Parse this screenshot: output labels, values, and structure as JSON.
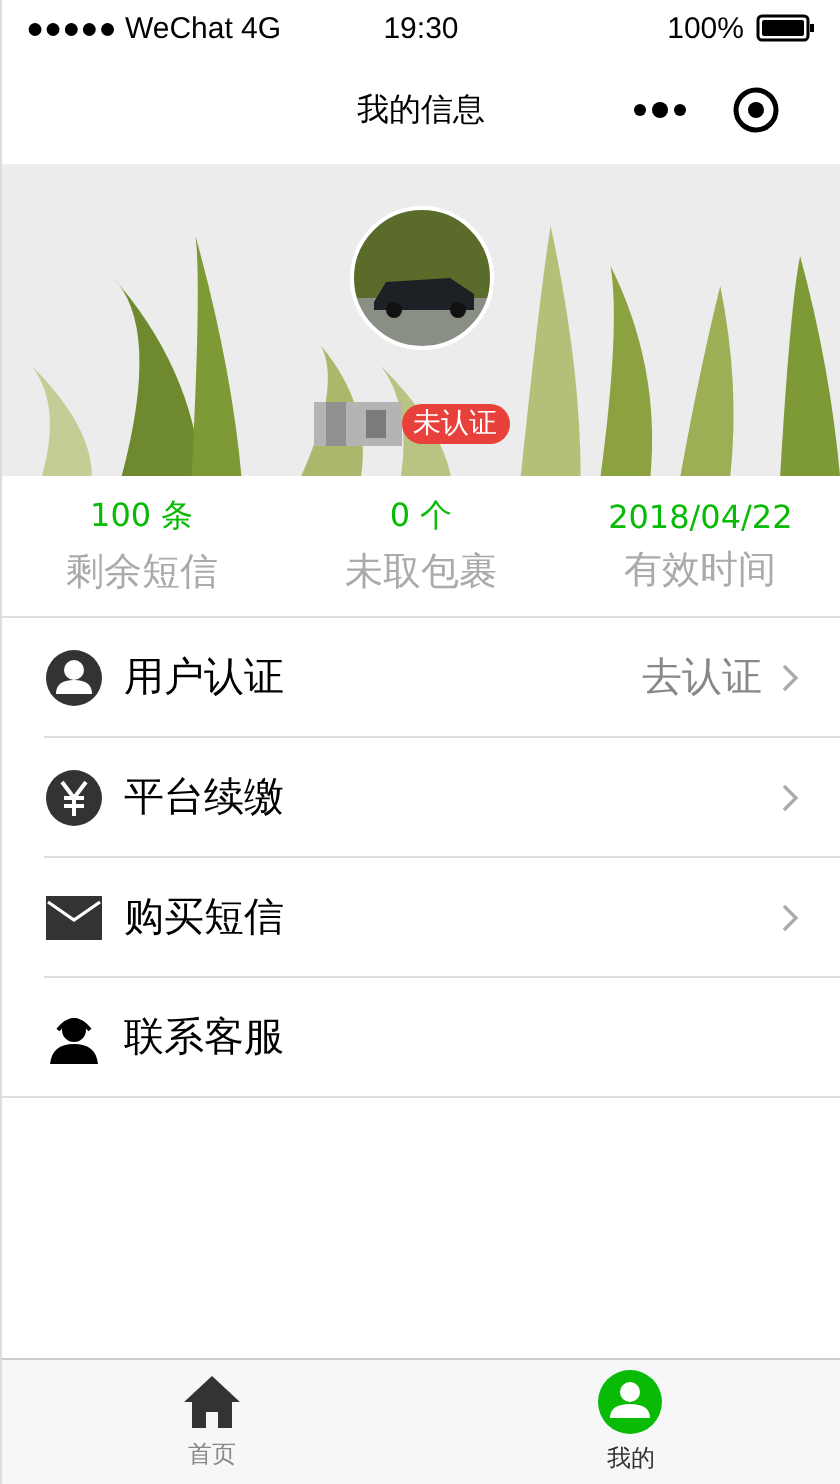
{
  "status_bar": {
    "carrier": "●●●●● WeChat 4G",
    "time": "19:30",
    "battery": "100%"
  },
  "nav": {
    "title": "我的信息"
  },
  "profile": {
    "badge": "未认证"
  },
  "stats": [
    {
      "value": "100 条",
      "label": "剩余短信"
    },
    {
      "value": "0 个",
      "label": "未取包裹"
    },
    {
      "value": "2018/04/22",
      "label": "有效时间"
    }
  ],
  "menu": [
    {
      "kind": "user",
      "label": "用户认证",
      "value": "去认证",
      "has_arrow": true
    },
    {
      "kind": "yen",
      "label": "平台续缴",
      "has_arrow": true
    },
    {
      "kind": "mail",
      "label": "购买短信",
      "has_arrow": true
    },
    {
      "kind": "agent",
      "label": "联系客服",
      "has_arrow": false
    }
  ],
  "tabs": [
    {
      "kind": "home",
      "label": "首页",
      "selected": false
    },
    {
      "kind": "user",
      "label": "我的",
      "selected": true
    }
  ]
}
